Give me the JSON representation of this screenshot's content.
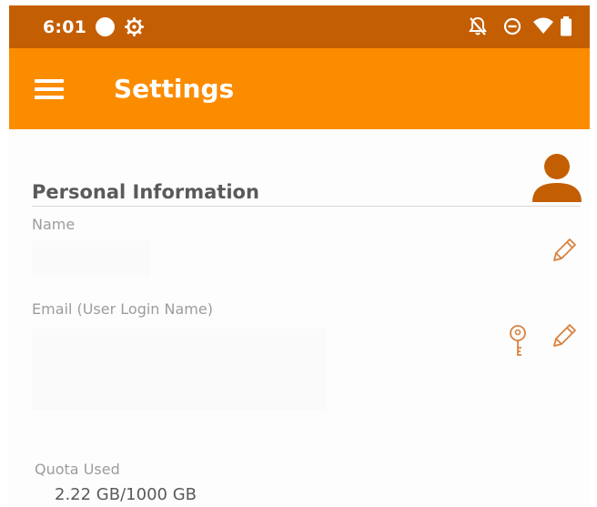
{
  "status_bar": {
    "time": "6:01",
    "icons": [
      "record-dot-icon",
      "settings-gear-icon",
      "notifications-off-icon",
      "do-not-disturb-icon",
      "wifi-icon",
      "battery-icon"
    ]
  },
  "app_bar": {
    "title": "Settings",
    "menu_icon": "hamburger-menu-icon",
    "color": "#fb8c00",
    "status_color": "#c45e02"
  },
  "personal_info": {
    "section_title": "Personal Information",
    "avatar_icon": "person-icon",
    "name_label": "Name",
    "name_value": "",
    "email_label": "Email (User Login Name)",
    "email_value": "",
    "edit_icon": "pencil-icon",
    "key_icon": "key-icon",
    "icon_color": "#d9823f"
  },
  "quota": {
    "label": "Quota Used",
    "value": "2.22 GB/1000 GB"
  }
}
